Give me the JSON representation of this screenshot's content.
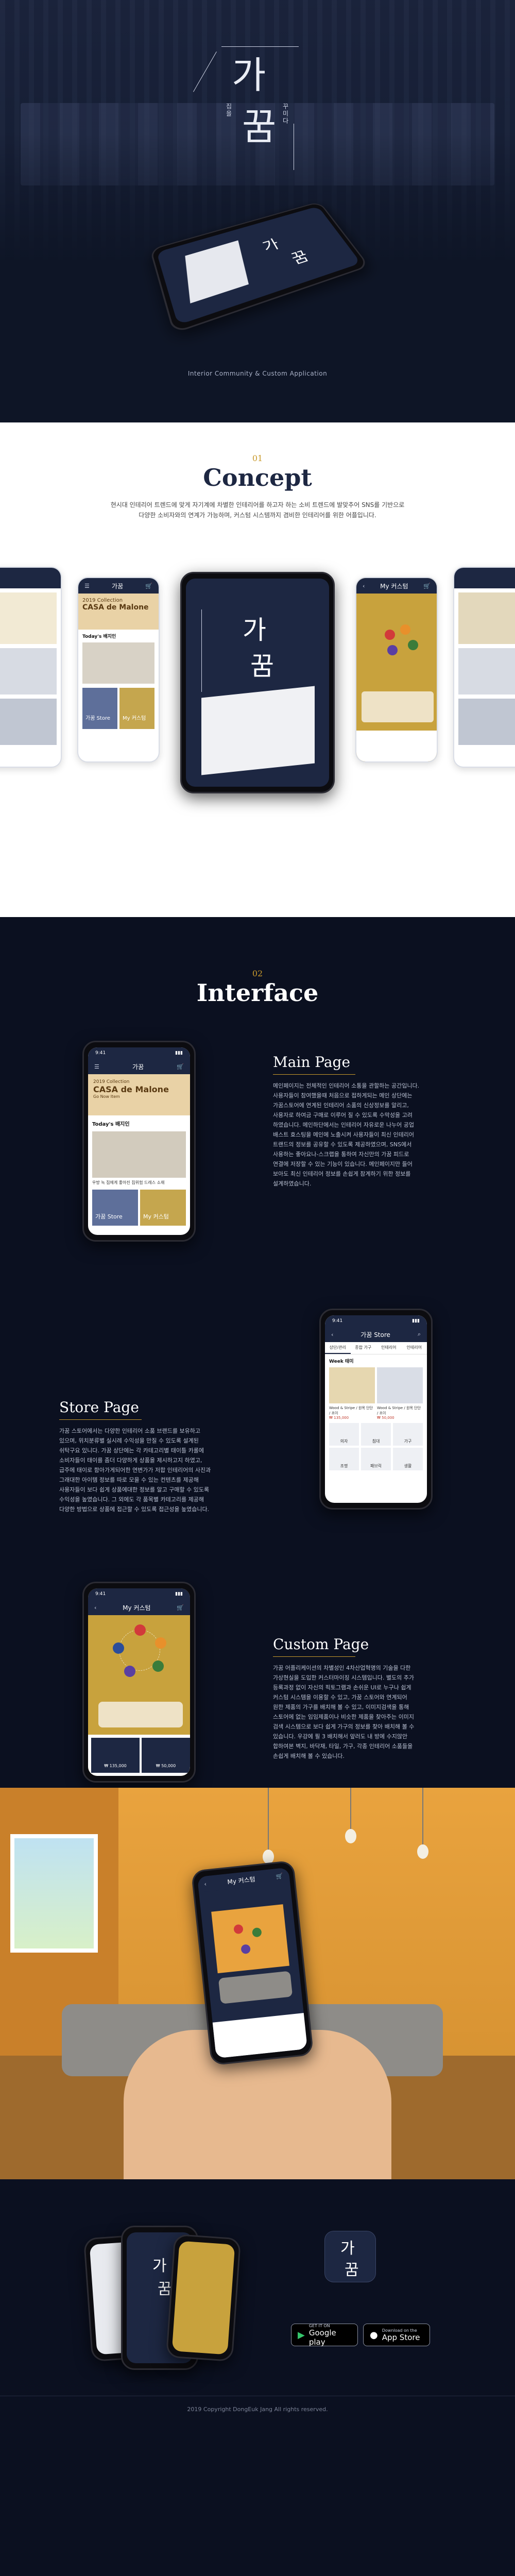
{
  "hero": {
    "logo_char_1": "가",
    "logo_char_2": "꿈",
    "logo_side_left": "집을",
    "logo_side_right": "꾸미다",
    "caption": "Interior Community & Custom Application"
  },
  "concept": {
    "number": "01",
    "title": "Concept",
    "desc_line1": "현시대 인테리어 트렌드에 맞게 자기계에 차별한 인테리어를 하고자 하는 소비 트렌드에 발맞추어 SNS를 기반으로",
    "desc_line2": "다양한 소비자와의 연계가 가능하며, 커스텀 시스템까지 겸비한 인테리어를 위한 어플입니다."
  },
  "app": {
    "time": "9:41",
    "home_title": "가꿈",
    "mycustom_title": "My 커스텀",
    "store_title": "가꿈 Store",
    "banner_line1": "2019 Collection",
    "banner_line2": "CASA de Malone",
    "banner_line3": "Go Now Item",
    "today_label": "Today's 배지인",
    "today_caption": "우방 녹 집에게 좋아진 집위험 드레스 소재",
    "today_caption2": "SKAD 인테리어 가구와 50% 5,700",
    "store_tile": "가꿈 Store",
    "mycustom_tile": "My 커스텀",
    "week_label": "Week 태미",
    "tabs": [
      "상단/관리",
      "종합 가구",
      "인테리어",
      "인테리어"
    ],
    "product_name": "Wood & Stripe / 원목 단단 / 조이",
    "product_price": "₩ 135,000",
    "product_name2": "Wood & Stripe / 원목 단단 / 조이",
    "product_price2": "₩ 50,000",
    "cats": [
      "의자",
      "침대",
      "가구",
      "조명",
      "패브릭",
      "생활"
    ],
    "custom_price": "₩ 135,000",
    "custom_price2": "₩ 50,000"
  },
  "interface": {
    "number": "02",
    "title": "Interface",
    "main_title": "Main Page",
    "main_desc": [
      "메인페이지는 전체적인 인테리어 소통을 관할하는 공간입니다.",
      "사용자들이 참여했을때 처음으로 접하게되는 메인 상단에는",
      "가꿈스토어에 연계된 인테리어 소품의 신상정보를 알리고,",
      "사용자로 하여금 구매로 이루어 질 수 있도록 수막성을 고려",
      "하였습니다. 메인하단에서는 인테리어 자유로운 나누어 공업",
      "배스트 효스팅을 메인에 노출시켜 사용자들이 최신 인테리어",
      "트랜드의 정보를 공유할 수 있도록 제공하였으며, SNS에서",
      "사용하는 좋아요나-스크랩을 통하여 자신만의 가꿈 피드로",
      "연결에 저장할 수 있는 기능이 있습니다. 메인페이지만 들어",
      "보아도 최신 인테리어 정보를 손쉽게 참계하기 위한 정보를",
      "설계하였습니다."
    ],
    "store_title": "Store Page",
    "store_desc": [
      "가꿈 스토어에서는 다양한 인테리어 소품 브랜드를 보유하고",
      "있으며, 위치분류별 실시례 수익성을 만질 수 있도록 설계된",
      "쉬탁구요 있니다. 가꿈 상단에는 각 카테고리별 태이틀 카롤에",
      "소비자들이 태이를 좀더 다양하게 상품을 제시하고지 하였고,",
      "급주에 태이로 함아가게되어한 연변가가 저합 인테리어의 사진과",
      "그래대한 아이템 정보를 따로 모을 수 있는 컨텐츠를 제공해",
      "사용자들이 보다 쉽게 상품에대한 정보를 알고 구매할 수 있도록",
      "수익성을 높였습니다. 그 외에도 각 품목별 카테고리를 제공해",
      "다양한 방법으로 상품에 접근할 수 있도록 접근성을 높였습니다."
    ],
    "custom_title": "Custom Page",
    "custom_desc": [
      "가꿈 어플리케이션의 차별성인 4차산업혁명의 기술을 다한",
      "가상현실을 도입한 커스터마이징 시스템입니다. 별도의 추가",
      "등록과정 없이 자신의 픽토그램과 손쉬운 UI로 누구나 쉽게",
      "커스텀 시스템을 이용할 수 있고, 가꿈 스토어와 연계되어",
      "원한 제품의 가구를 배치해 볼 수 있고, 이미지검색을 통해",
      "스토어에 없는 임임제품이나 비슷한 제품을 찾아주는 이미지",
      "검색 시스템으로 보다 쉽게 가구의 정보를 찾아 배치해 볼 수",
      "있습니다. 우강에 필 3 배치해서 앞러도 내 방에 수지않안",
      "합하여본 벽지, 바닥재, 타일, 가구, 각종 인테리어 소품들을",
      "손쉽게 배치해 볼 수 있습니다."
    ]
  },
  "footer": {
    "logo_char_1": "가",
    "logo_char_2": "꿈",
    "google_small": "GET IT ON",
    "google_big": "Google play",
    "apple_small": "Download on the",
    "apple_big": "App Store",
    "copyright": "2019 Copyright DongEuk Jang All rights reserved."
  },
  "colors": {
    "navy": "#1d2742",
    "gold": "#c99a2c",
    "orange_wall": "#e9a33e"
  },
  "icons": [
    "menu-icon",
    "search-icon",
    "cart-icon",
    "google-play-icon",
    "apple-icon"
  ]
}
